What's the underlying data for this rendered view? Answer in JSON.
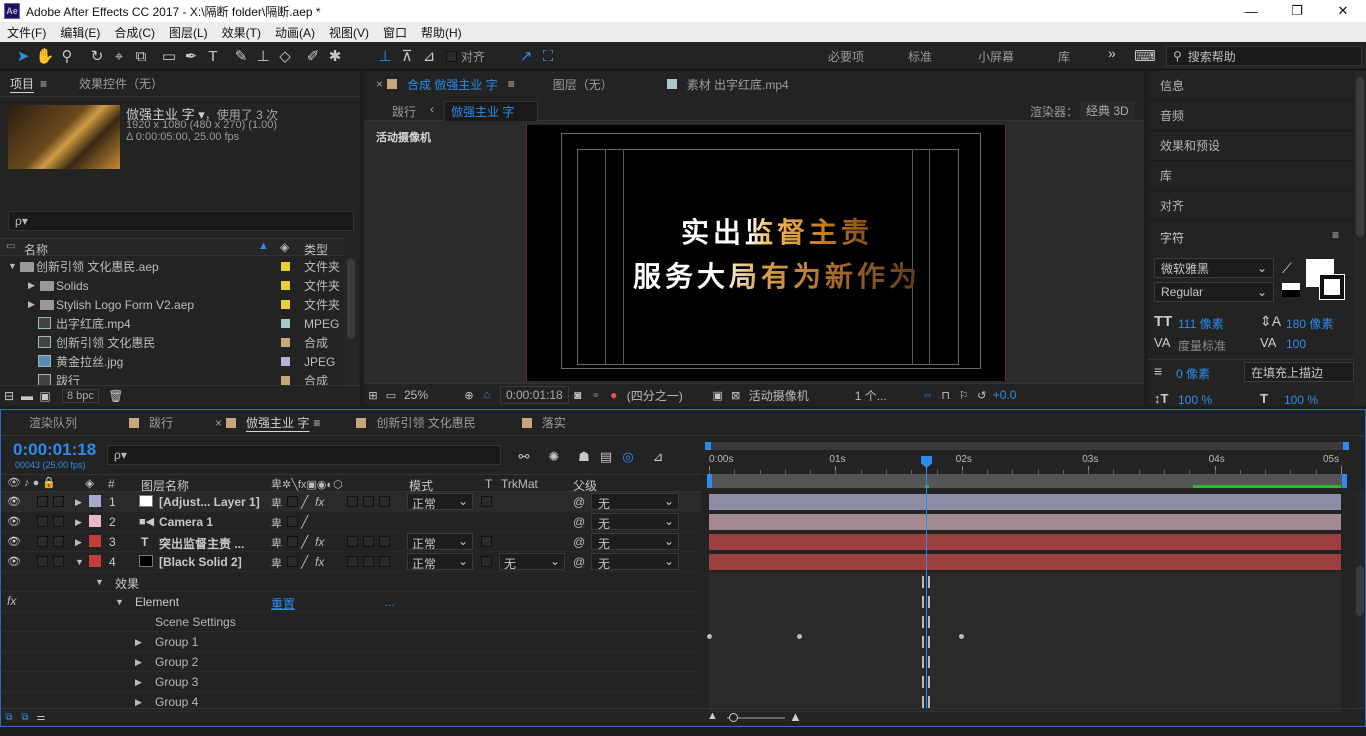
{
  "window": {
    "title": "Adobe After Effects CC 2017 - X:\\隔断 folder\\隔断.aep *",
    "logo": "Ae",
    "min": "—",
    "max": "❐",
    "close": "✕"
  },
  "menu": [
    "文件(F)",
    "编辑(E)",
    "合成(C)",
    "图层(L)",
    "效果(T)",
    "动画(A)",
    "视图(V)",
    "窗口",
    "帮助(H)"
  ],
  "toolbar": {
    "snap_label": "对齐",
    "workspaces": [
      "必要项",
      "标准",
      "小屏幕",
      "库"
    ],
    "more": "»",
    "search_placeholder": "搜索帮助"
  },
  "project": {
    "tabs": [
      "项目",
      "效果控件（无）"
    ],
    "selected": {
      "name": "倣强主业 字 ▾",
      "used": "，使用了 3 次",
      "dims": "1920 x 1080  (480 x 270) (1.00)",
      "duration": "Δ 0:00:05:00, 25.00 fps"
    },
    "search_placeholder": "ρ▾",
    "col_name": "名称",
    "col_type": "类型",
    "items": [
      {
        "name": "创新引领  文化惠民.aep",
        "type": "文件夹",
        "color": "#e6d237",
        "kind": "folder",
        "indent": 0,
        "expanded": true
      },
      {
        "name": "Solids",
        "type": "文件夹",
        "color": "#e6d237",
        "kind": "folder",
        "indent": 1
      },
      {
        "name": "Stylish Logo Form V2.aep",
        "type": "文件夹",
        "color": "#e6d237",
        "kind": "folder",
        "indent": 1
      },
      {
        "name": "出字红底.mp4",
        "type": "MPEG",
        "color": "#a9c8c8",
        "kind": "file",
        "indent": 1
      },
      {
        "name": "创新引领  文化惠民",
        "type": "合成",
        "color": "#c7a77b",
        "kind": "comp",
        "indent": 1
      },
      {
        "name": "黄金拉丝.jpg",
        "type": "JPEG",
        "color": "#b8b0d8",
        "kind": "image",
        "indent": 1
      },
      {
        "name": "跋行",
        "type": "合成",
        "color": "#c7a77b",
        "kind": "comp",
        "indent": 1
      }
    ],
    "bpc": "8 bpc"
  },
  "viewer": {
    "tabs": [
      "合成 倣强主业 字",
      "图层（无）",
      "素材 出字红底.mp4"
    ],
    "crumbs": [
      "跋行",
      "倣强主业 字"
    ],
    "renderer_label": "渲染器：",
    "renderer": "经典 3D",
    "camera_label": "活动摄像机",
    "text_line1": "实出监督主责",
    "text_line2": "服务大局有为新作为",
    "zoom": "25%",
    "time": "0:00:01:18",
    "res": "(四分之一)",
    "view_cam": "活动摄像机",
    "views": "1 个...",
    "exposure": "+0.0"
  },
  "right": {
    "items": [
      "信息",
      "音频",
      "效果和预设",
      "库",
      "对齐"
    ],
    "char_title": "字符",
    "font": "微软雅黑",
    "style": "Regular",
    "size": "111 像素",
    "leading": "180 像素",
    "kerning": "度量标准",
    "tracking": "100",
    "stroke": "0 像素",
    "stroke_mode": "在填充上描边",
    "vscale": "100 %",
    "hscale": "100 %"
  },
  "timeline": {
    "tabs": [
      "渲染队列",
      "跋行",
      "倣强主业 字",
      "创新引领  文化惠民",
      "落实"
    ],
    "tab_colors": [
      "",
      "#c7a77b",
      "#c7a77b",
      "#c7a77b",
      "#c7a77b"
    ],
    "time": "0:00:01:18",
    "frames": "00043 (25.00 fps)",
    "search_placeholder": "ρ▾",
    "cols": {
      "num": "#",
      "name": "图层名称",
      "mode": "模式",
      "t": "T",
      "trk": "TrkMat",
      "parent": "父级"
    },
    "ruler": [
      "0:00s",
      "01s",
      "02s",
      "03s",
      "04s",
      "05s"
    ],
    "layers": [
      {
        "num": "1",
        "name": "[Adjust... Layer 1]",
        "color": "#a9a9d2",
        "thumb": "#ffffff",
        "mode": "正常",
        "parent": "无",
        "bar": "#8d8da6"
      },
      {
        "num": "2",
        "name": "Camera 1",
        "color": "#e6b8c5",
        "thumb": "",
        "mode": "",
        "parent": "无",
        "bar": "#a48990"
      },
      {
        "num": "3",
        "name": "突出监督主责 ...",
        "color": "#c43c3c",
        "thumb": "",
        "mode": "正常",
        "parent": "无",
        "bar": "#9c4040"
      },
      {
        "num": "4",
        "name": "[Black Solid 2]",
        "color": "#c43c3c",
        "thumb": "#000000",
        "mode": "正常",
        "trk": "无",
        "parent": "无",
        "bar": "#9c4040"
      }
    ],
    "effects_label": "效果",
    "element_label": "Element",
    "reset": "重置",
    "ellipsis": "...",
    "fx_label": "fx",
    "sub": [
      "Scene Settings",
      "Group 1",
      "Group 2",
      "Group 3",
      "Group 4"
    ]
  }
}
